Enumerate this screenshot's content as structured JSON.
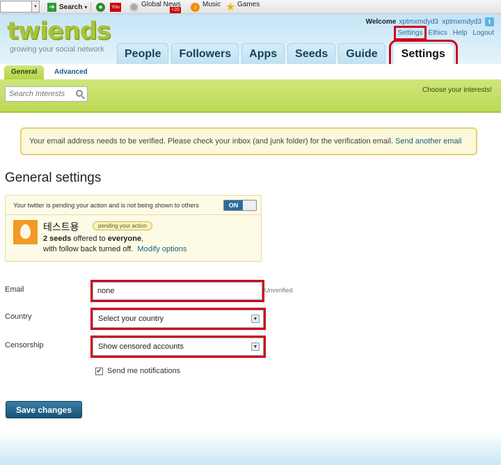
{
  "browser_toolbar": {
    "search_label": "Search",
    "items": [
      "Global News",
      "Music",
      "Games"
    ],
    "news_badge": "+20"
  },
  "header": {
    "logo": "twiends",
    "tagline": "growing your social network",
    "welcome": "Welcome",
    "username": "xptmxmdyd3",
    "handle": "xptmxmdyd3",
    "top_links": [
      "Settings",
      "Ethics",
      "Help",
      "Logout"
    ],
    "nav_tabs": [
      "People",
      "Followers",
      "Apps",
      "Seeds",
      "Guide",
      "Settings"
    ]
  },
  "subtabs": [
    "General",
    "Advanced"
  ],
  "search": {
    "placeholder": "Search Interests"
  },
  "choose_interests": "Choose your interests!",
  "notice": {
    "text": "Your email address needs to be verified. Please check your inbox (and junk folder) for the verification email.",
    "link": "Send another email"
  },
  "page_title": "General settings",
  "pending": {
    "header": "Your twitter is pending your action and is not being shown to others",
    "toggle": "ON",
    "account_name": "테스트용",
    "badge": "pending your action",
    "seeds_count": "2 seeds",
    "offered_to": " offered to ",
    "audience": "everyone",
    "follow_back": "with follow back turned off.",
    "modify_link": "Modify options"
  },
  "form": {
    "email_label": "Email",
    "email_value": "none",
    "email_status": "Unverified",
    "country_label": "Country",
    "country_value": "Select your country",
    "censorship_label": "Censorship",
    "censorship_value": "Show censored accounts",
    "notifications_label": "Send me notifications",
    "notifications_checked": true
  },
  "save_button": "Save changes",
  "colors": {
    "highlight": "#d0021b",
    "accent_green": "#b4d449",
    "link_blue": "#1c5c80"
  }
}
